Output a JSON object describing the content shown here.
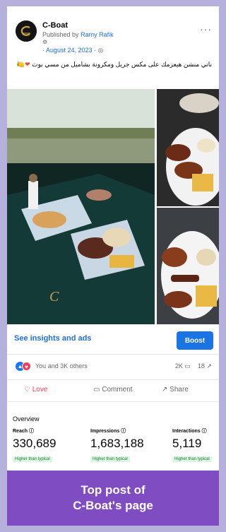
{
  "post": {
    "page_name": "C-Boat",
    "published_prefix": "Published by",
    "published_author": "Ramy Rafik",
    "meta_icon": "⚙",
    "date_prefix": "·",
    "date": "August 24, 2023",
    "date_suffix": "·",
    "globe_icon": "globe-icon",
    "more_label": "···",
    "caption": "ناتي منشن هيعزمك على مكس جريل ومكرونة بشاميل من مسي بوت",
    "caption_emojis": "❤🍋"
  },
  "photos": {
    "main_alt": "Grilled meat platter on boat deck",
    "top_alt": "Grilled chicken and fries plate",
    "bottom_alt": "Kofta, chicken and rice plate",
    "logo_text": "C-Boat"
  },
  "insights": {
    "link_label": "See insights and ads",
    "boost_label": "Boost"
  },
  "reactions": {
    "summary": "You and 3K others",
    "comments": "2K",
    "shares": "18",
    "like_glyph": "👍",
    "love_glyph": "♥"
  },
  "actions": {
    "love_label": "Love",
    "comment_label": "Comment",
    "share_label": "Share",
    "love_icon": "♡",
    "comment_icon": "💬",
    "share_icon": "↗"
  },
  "overview": {
    "title": "Overview",
    "metrics": [
      {
        "label": "Reach",
        "value": "330,689",
        "badge": "Higher than typical"
      },
      {
        "label": "Impressions",
        "value": "1,683,188",
        "badge": "Higher than typical"
      },
      {
        "label": "Interactions",
        "value": "5,119",
        "badge": "Higher than typical"
      }
    ]
  },
  "banner": {
    "line1": "Top post of",
    "line2": "C-Boat's page"
  },
  "colors": {
    "background": "#b6b1dc",
    "banner": "#7f4cc2",
    "accent": "#1b74e4",
    "love": "#f33e58"
  }
}
